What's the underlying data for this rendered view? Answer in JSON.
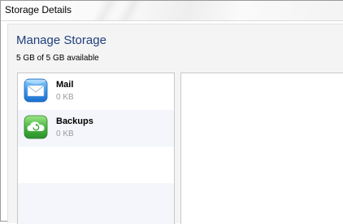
{
  "window": {
    "title": "Storage Details"
  },
  "header": {
    "title": "Manage Storage",
    "subtitle": "5 GB of 5 GB available"
  },
  "storage_list": {
    "items": [
      {
        "name": "Mail",
        "size": "0 KB",
        "icon": "mail-icon"
      },
      {
        "name": "Backups",
        "size": "0 KB",
        "icon": "backup-icon"
      }
    ]
  },
  "colors": {
    "heading": "#1f3f7a",
    "mail_icon": "#2f8be0",
    "backup_icon": "#3cae3c",
    "secondary_text": "#9b9b9b"
  }
}
